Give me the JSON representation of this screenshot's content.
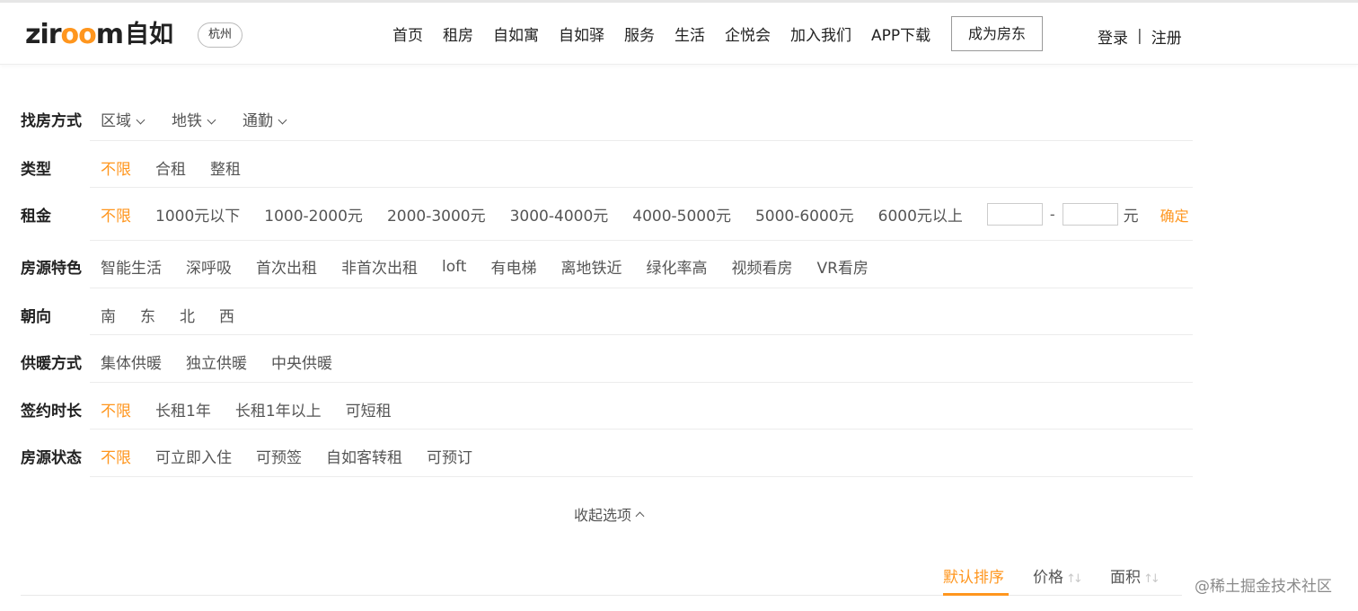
{
  "header": {
    "logo_word_a": "zir",
    "logo_word_oo": "oo",
    "logo_word_b": "m",
    "logo_cn": "自如",
    "city": "杭州",
    "nav": [
      "首页",
      "租房",
      "自如寓",
      "自如驿",
      "服务",
      "生活",
      "企悦会",
      "加入我们",
      "APP下载"
    ],
    "landlord_button": "成为房东",
    "login": "登录",
    "separator": "|",
    "register": "注册"
  },
  "filters": {
    "method": {
      "label": "找房方式",
      "options": [
        "区域",
        "地铁",
        "通勤"
      ]
    },
    "type": {
      "label": "类型",
      "options": [
        "不限",
        "合租",
        "整租"
      ],
      "active": "不限"
    },
    "rent": {
      "label": "租金",
      "options": [
        "不限",
        "1000元以下",
        "1000-2000元",
        "2000-3000元",
        "3000-4000元",
        "4000-5000元",
        "5000-6000元",
        "6000元以上"
      ],
      "active": "不限",
      "min_value": "",
      "max_value": "",
      "dash": "-",
      "unit": "元",
      "confirm": "确定"
    },
    "features": {
      "label": "房源特色",
      "options": [
        "智能生活",
        "深呼吸",
        "首次出租",
        "非首次出租",
        "loft",
        "有电梯",
        "离地铁近",
        "绿化率高",
        "视频看房",
        "VR看房"
      ]
    },
    "orientation": {
      "label": "朝向",
      "options": [
        "南",
        "东",
        "北",
        "西"
      ]
    },
    "heating": {
      "label": "供暖方式",
      "options": [
        "集体供暖",
        "独立供暖",
        "中央供暖"
      ]
    },
    "lease": {
      "label": "签约时长",
      "options": [
        "不限",
        "长租1年",
        "长租1年以上",
        "可短租"
      ],
      "active": "不限"
    },
    "status": {
      "label": "房源状态",
      "options": [
        "不限",
        "可立即入住",
        "可预签",
        "自如客转租",
        "可预订"
      ],
      "active": "不限"
    },
    "collapse_label": "收起选项"
  },
  "sort": {
    "default": "默认排序",
    "price": "价格",
    "area": "面积",
    "arrows": "↑↓"
  },
  "watermark": "@稀土掘金技术社区",
  "colors": {
    "accent": "#ff961e",
    "text": "#333333",
    "muted": "#555555",
    "divider": "#ececec"
  }
}
